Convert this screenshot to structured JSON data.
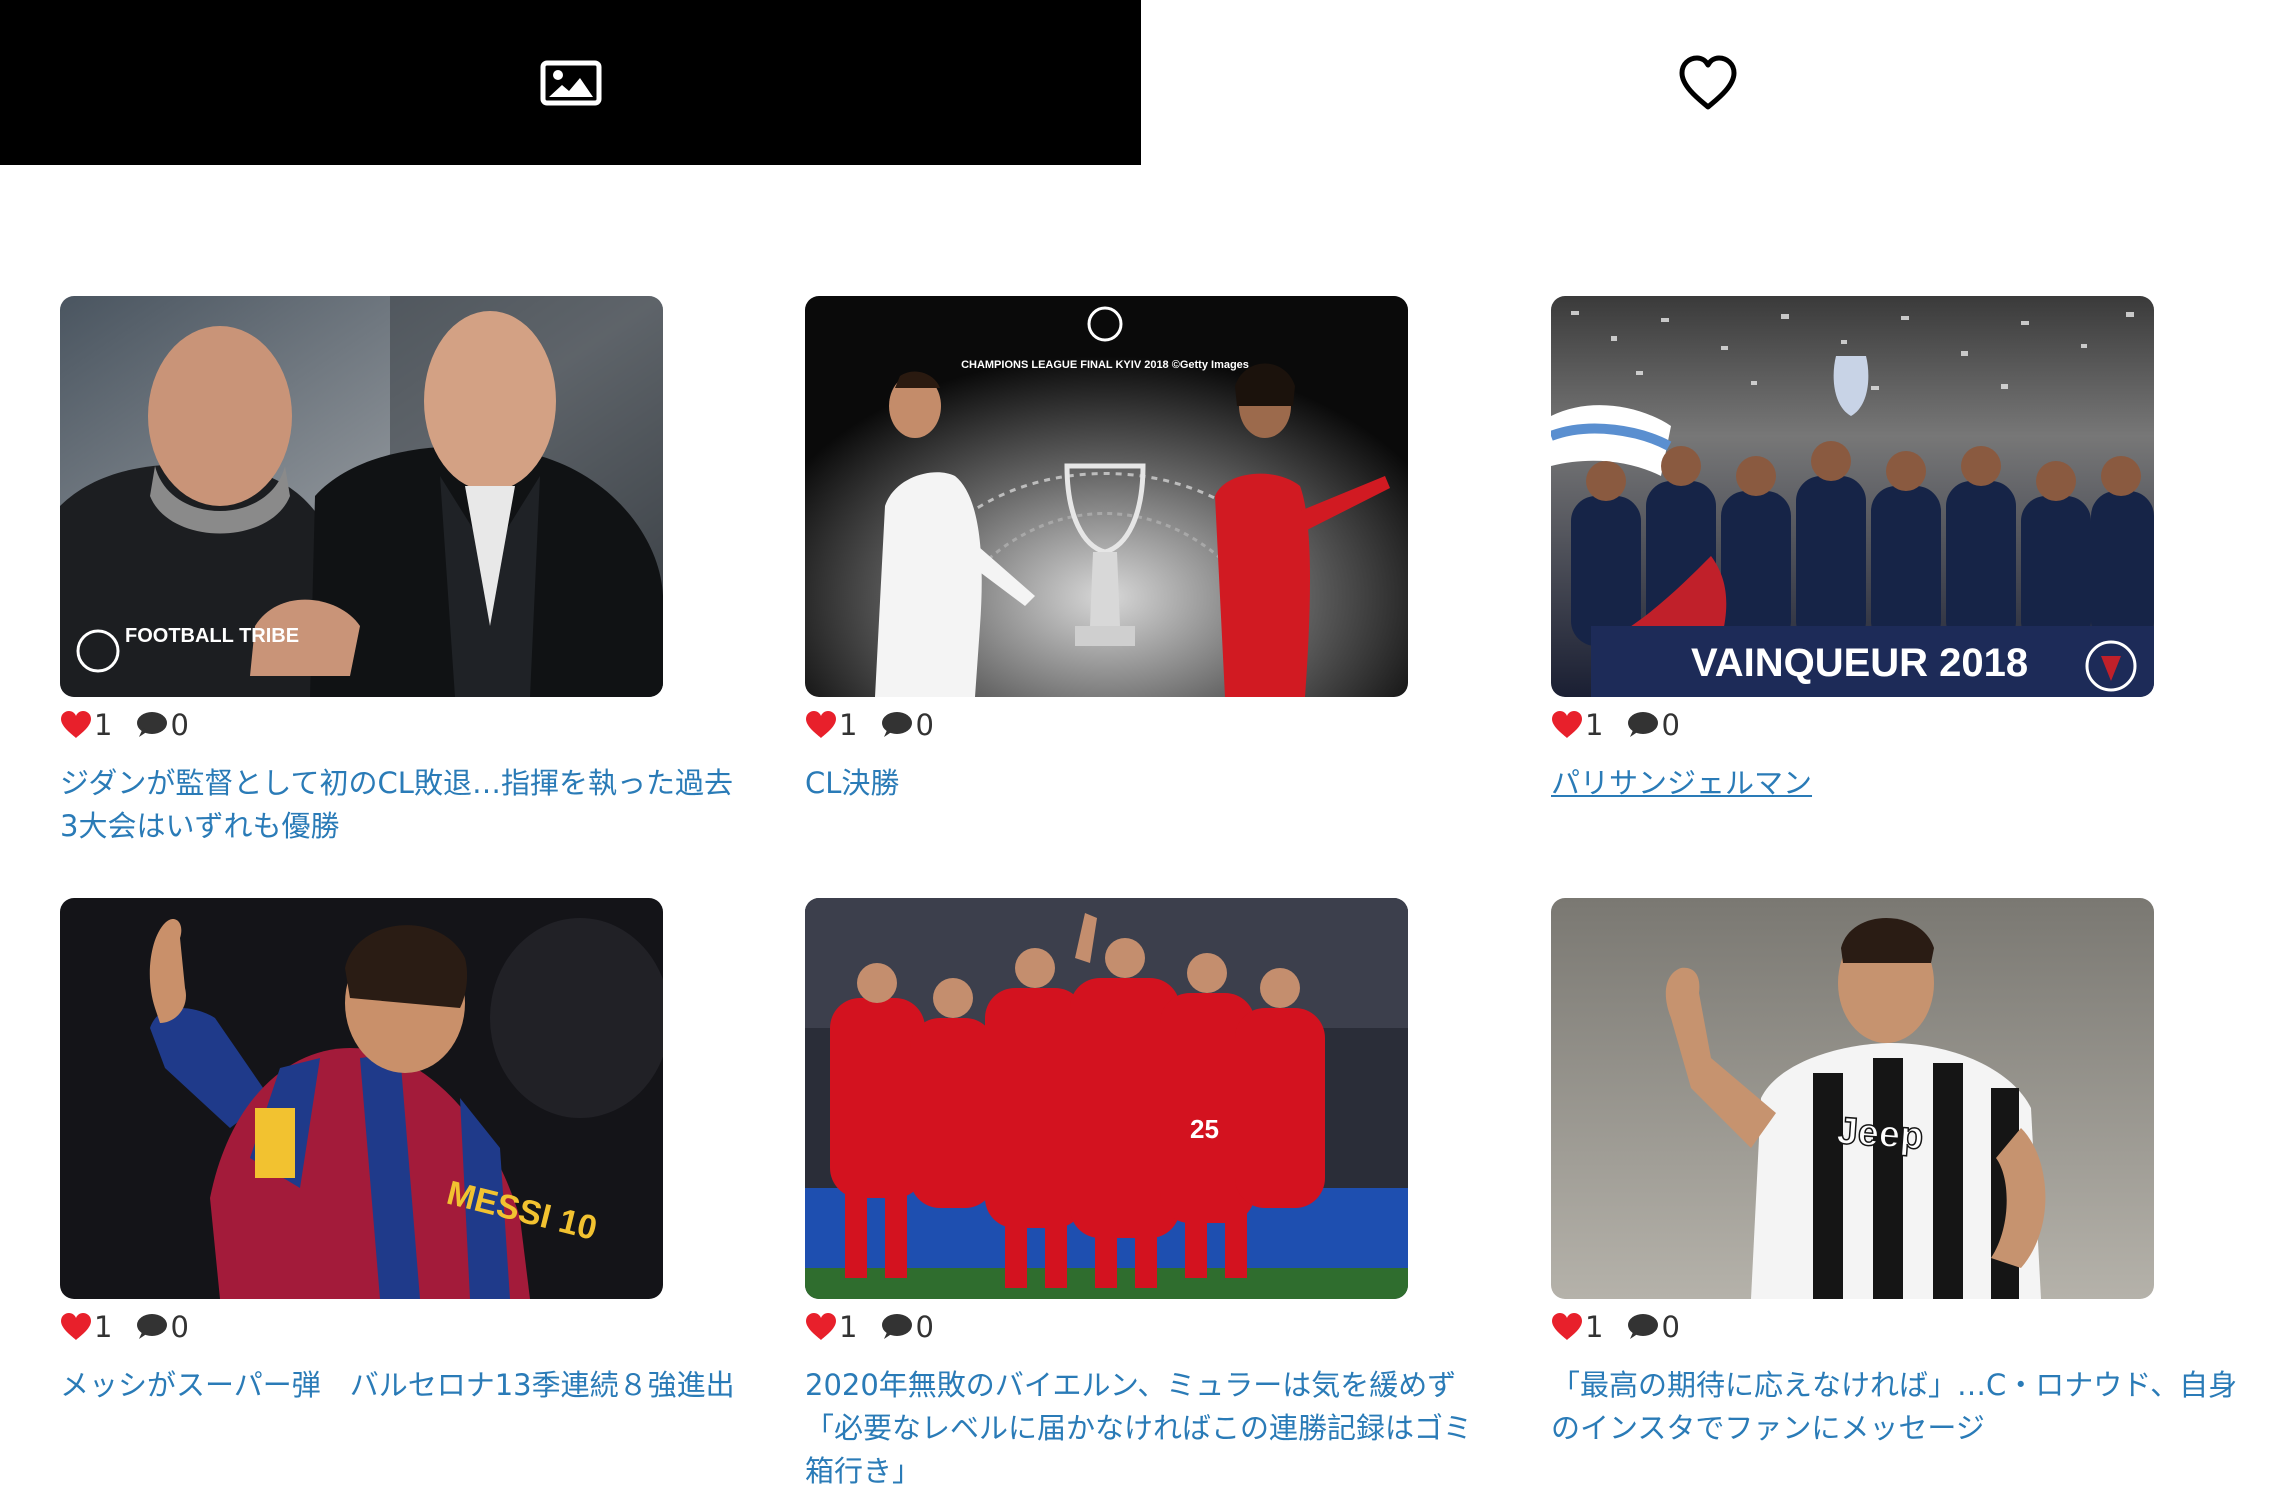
{
  "tabs": [
    {
      "icon": "image-icon",
      "active": true
    },
    {
      "icon": "heart-outline-icon",
      "active": false
    }
  ],
  "colors": {
    "active_tab_bg": "#000000",
    "link": "#2a7bb7",
    "like_heart": "#e8202b",
    "comment_bubble": "#333333"
  },
  "cards": [
    {
      "likes": "1",
      "comments": "0",
      "title": "ジダンが監督として初のCL敗退…指揮を執った過去3大会はいずれも優勝",
      "image_text": "FOOTBALL TRIBE"
    },
    {
      "likes": "1",
      "comments": "0",
      "title": "CL決勝",
      "image_text": "CHAMPIONS LEAGUE FINAL KYIV 2018 ©Getty Images"
    },
    {
      "likes": "1",
      "comments": "0",
      "title": "パリサンジェルマン",
      "image_text": "VAINQUEUR 2018"
    },
    {
      "likes": "1",
      "comments": "0",
      "title": "メッシがスーパー弾　バルセロナ13季連続８強進出",
      "image_text": "MESSI 10"
    },
    {
      "likes": "1",
      "comments": "0",
      "title": "2020年無敗のバイエルン、ミュラーは気を緩めず「必要なレベルに届かなければこの連勝記録はゴミ箱行き」",
      "image_text": "25"
    },
    {
      "likes": "1",
      "comments": "0",
      "title": "「最高の期待に応えなければ」…C・ロナウド、自身のインスタでファンにメッセージ",
      "image_text": "Jeep"
    }
  ]
}
